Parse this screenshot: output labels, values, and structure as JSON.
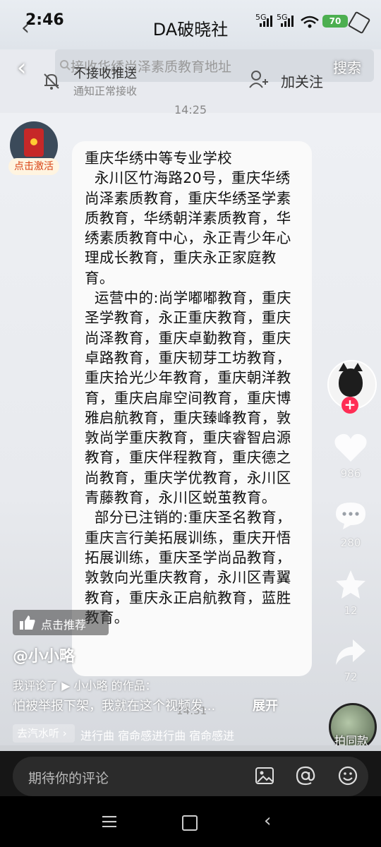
{
  "status_bar": {
    "time": "2:46",
    "chat_title": "DA破晓社",
    "signal1": "5G",
    "signal2": "5G",
    "battery": "70"
  },
  "top": {
    "search_text": "接收华绣尚泽素质教育地址",
    "search_button": "搜索",
    "notify_title": "不接收推送",
    "notify_sub": "通知正常接收",
    "follow": "加关注"
  },
  "chat": {
    "timestamp_1": "14:25",
    "activate": "点击激活",
    "message": "重庆华绣中等专业学校\n  永川区竹海路20号，重庆华绣尚泽素质教育，重庆华绣圣学素质教育，华绣朝洋素质教育，华绣素质教育中心，永正青少年心理成长教育，重庆永正家庭教育。\n  运营中的:尚学嘟嘟教育，重庆圣学教育，永正重庆教育，重庆尚泽教育，重庆卓勤教育，重庆卓路教育，重庆韧芽工坊教育，重庆拾光少年教育，重庆朝洋教育，重庆启扉空间教育，重庆博雅启航教育，重庆臻峰教育，敦敦尚学重庆教育，重庆睿智启源教育，重庆伴程教育，重庆德之尚教育，重庆学优教育，永川区青藤教育，永川区蜕茧教育。\n  部分已注销的:重庆圣名教育，重庆言行美拓展训练，重庆开悟拓展训练，重庆圣学尚品教育，敦敦向光重庆教育，永川区青翼教育，重庆永正启航教育，蓝胜教育。",
    "timestamp_2": "14:31"
  },
  "rail": {
    "likes": "986",
    "comments": "280",
    "favorites": "12",
    "shares": "72",
    "same_music": "拍同款"
  },
  "overlay": {
    "recommend": "点击推荐",
    "author": "@小小略",
    "comment_line_1": "我评论了 ▶ 小小略 的作品：",
    "comment_line_2": "怕被举报下架，我就在这个视频发...",
    "expand": "展开",
    "music_tag": "去汽水听 ›",
    "music_scroll": "进行曲   宿命感进行曲   宿命感进"
  },
  "comment_bar": {
    "placeholder": "期待你的评论"
  },
  "colors": {
    "accent": "#ff2d55",
    "battery": "#4caf50",
    "activate_text": "#d84315"
  }
}
